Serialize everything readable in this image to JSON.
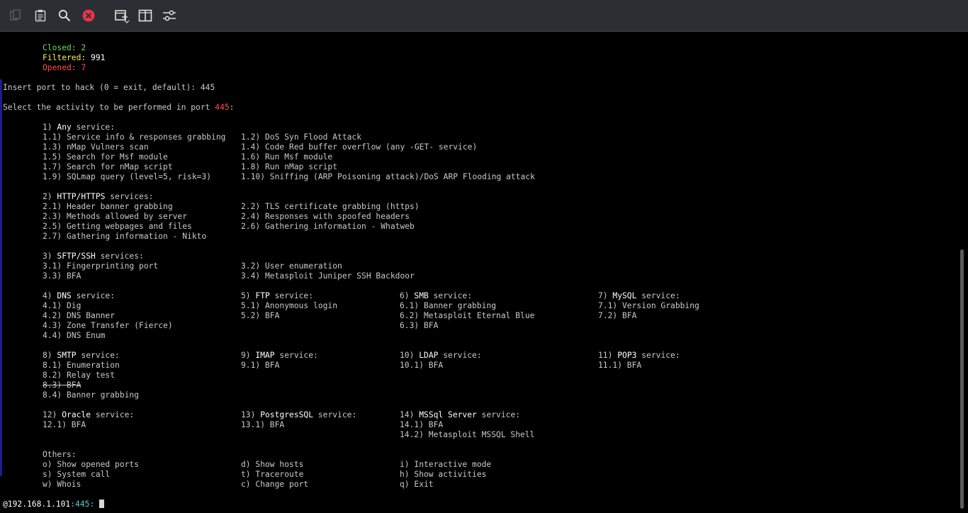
{
  "toolbar": {
    "icons": [
      "copy-icon",
      "paste-icon",
      "search-icon",
      "close-icon",
      "new-tab-icon",
      "split-view-icon",
      "preferences-icon"
    ]
  },
  "summary": {
    "closed": "Closed: 2",
    "filtered_label": "Filtered: ",
    "filtered_value": "991",
    "opened": "Opened: 7"
  },
  "prompt_port": "Insert port to hack (0 = exit, default): 445",
  "select_prefix": "Select the activity to be performed in port ",
  "select_port": "445",
  "select_suffix": ":",
  "any": {
    "num": "1) ",
    "name": "Any",
    "rest": " service:",
    "items": [
      [
        "1.1) Service info & responses grabbing",
        "1.2) DoS Syn Flood Attack"
      ],
      [
        "1.3) nMap Vulners scan",
        "1.4) Code Red buffer overflow (any -GET- service)"
      ],
      [
        "1.5) Search for Msf module",
        "1.6) Run Msf module"
      ],
      [
        "1.7) Search for nMap script",
        "1.8) Run nMap script"
      ],
      [
        "1.9) SQLmap query (level=5, risk=3)",
        "1.10) Sniffing (ARP Poisoning attack)/DoS ARP Flooding attack"
      ]
    ]
  },
  "http": {
    "num": "2) ",
    "name": "HTTP/HTTPS",
    "rest": " services:",
    "items": [
      [
        "2.1) Header banner grabbing",
        "2.2) TLS certificate grabbing (https)"
      ],
      [
        "2.3) Methods allowed by server",
        "2.4) Responses with spoofed headers"
      ],
      [
        "2.5) Getting webpages and files",
        "2.6) Gathering information - Whatweb"
      ],
      [
        "2.7) Gathering information - Nikto",
        ""
      ]
    ]
  },
  "ssh": {
    "num": "3) ",
    "name": "SFTP/SSH",
    "rest": " services:",
    "items": [
      [
        "3.1) Fingerprinting port",
        "3.2) User enumeration"
      ],
      [
        "3.3) BFA",
        "3.4) Metasploit Juniper SSH Backdoor"
      ]
    ]
  },
  "row4": [
    {
      "num": "4) ",
      "name": "DNS",
      "rest": " service:",
      "items": [
        "4.1) Dig",
        "4.2) DNS Banner",
        "4.3) Zone Transfer (Fierce)",
        "4.4) DNS Enum"
      ]
    },
    {
      "num": "5) ",
      "name": "FTP",
      "rest": " service:",
      "items": [
        "5.1) Anonymous login",
        "5.2) BFA"
      ]
    },
    {
      "num": "6) ",
      "name": "SMB",
      "rest": " service:",
      "items": [
        "6.1) Banner grabbing",
        "6.2) Metasploit Eternal Blue",
        "6.3) BFA"
      ]
    },
    {
      "num": "7) ",
      "name": "MySQL",
      "rest": " service:",
      "items": [
        "7.1) Version Grabbing",
        "7.2) BFA"
      ]
    }
  ],
  "row8": [
    {
      "num": "8) ",
      "name": "SMTP",
      "rest": " service:",
      "items": [
        "8.1) Enumeration",
        "8.2) Relay test",
        "8.3) BFA",
        "8.4) Banner grabbing"
      ]
    },
    {
      "num": "9) ",
      "name": "IMAP",
      "rest": " service:",
      "items": [
        "9.1) BFA"
      ]
    },
    {
      "num": "10) ",
      "name": "LDAP",
      "rest": " service:",
      "items": [
        "10.1) BFA"
      ]
    },
    {
      "num": "11) ",
      "name": "POP3",
      "rest": " service:",
      "items": [
        "11.1) BFA"
      ]
    }
  ],
  "row12": [
    {
      "num": "12) ",
      "name": "Oracle",
      "rest": " service:",
      "items": [
        "12.1) BFA"
      ]
    },
    {
      "num": "13) ",
      "name": "PostgresSQL",
      "rest": " service:",
      "items": [
        "13.1) BFA"
      ]
    },
    {
      "num": "14) ",
      "name": "MSSql Server",
      "rest": " service:",
      "items": [
        "14.1) BFA",
        "14.2) Metasploit MSSQL Shell"
      ]
    }
  ],
  "others": {
    "header": "Others:",
    "items": [
      [
        "o) Show opened ports",
        "d) Show hosts",
        "i) Interactive mode"
      ],
      [
        "s) System call",
        "t) Traceroute",
        "h) Show activities"
      ],
      [
        "w) Whois",
        "c) Change port",
        "q) Exit"
      ]
    ]
  },
  "shell": {
    "host": "@192.168.1.101",
    "sep": ":",
    "port": "445",
    "end": ": "
  }
}
